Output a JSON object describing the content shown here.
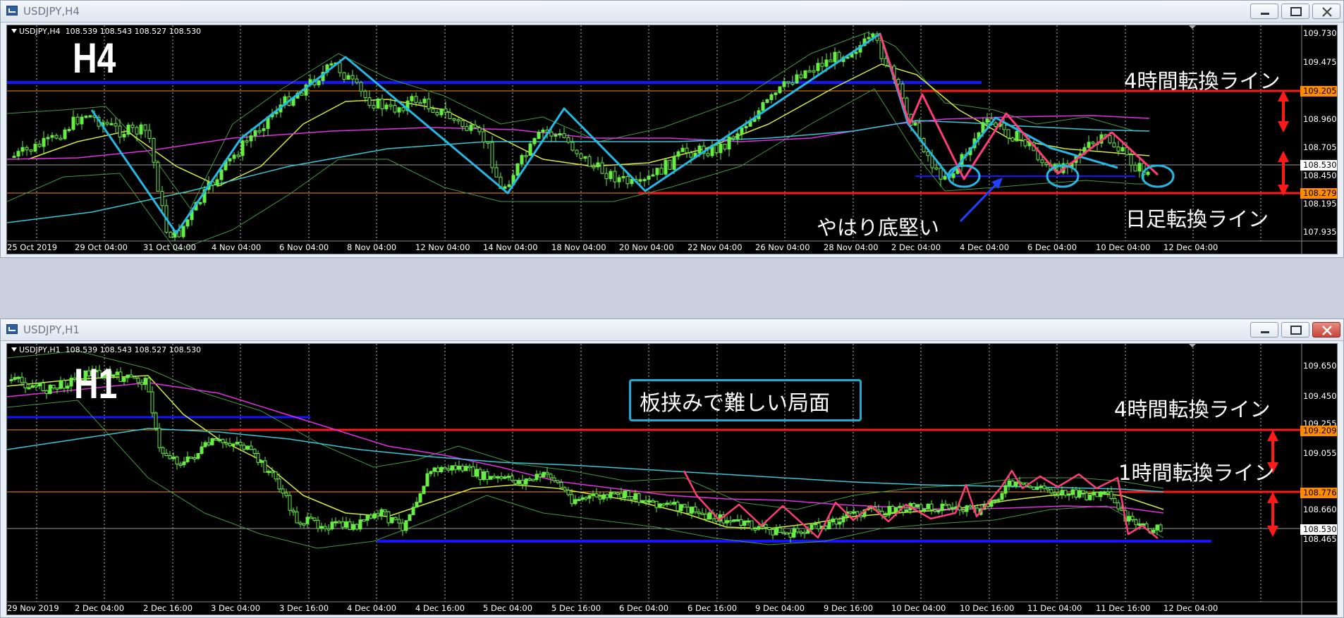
{
  "windows": [
    {
      "title": "USDJPY,H4",
      "symbol_line": "USDJPY,H4  108.539 108.543 108.527 108.530",
      "timeframe_label": "H4",
      "annotations": [
        "4時間転換ライン",
        "日足転換ライン",
        "やはり底堅い"
      ],
      "price_labels": [
        "109.730",
        "109.475",
        "108.960",
        "108.705",
        "108.450",
        "108.195",
        "107.935"
      ],
      "badges": [
        {
          "value": "109.205",
          "color": "#ff8c00"
        },
        {
          "value": "108.530",
          "color": "#ffffff"
        },
        {
          "value": "108.279",
          "color": "#ff8c00"
        }
      ],
      "time_labels": [
        "25 Oct 2019",
        "29 Oct 04:00",
        "31 Oct 04:00",
        "4 Nov 04:00",
        "6 Nov 04:00",
        "8 Nov 04:00",
        "12 Nov 04:00",
        "14 Nov 04:00",
        "18 Nov 04:00",
        "20 Nov 04:00",
        "22 Nov 04:00",
        "26 Nov 04:00",
        "28 Nov 04:00",
        "2 Dec 04:00",
        "4 Dec 04:00",
        "6 Dec 04:00",
        "10 Dec 04:00",
        "12 Dec 04:00"
      ]
    },
    {
      "title": "USDJPY,H1",
      "symbol_line": "USDJPY,H1  108.539 108.543 108.527 108.530",
      "timeframe_label": "H1",
      "annotations": [
        "板挟みで難しい局面",
        "4時間転換ライン",
        "1時間転換ライン"
      ],
      "price_labels": [
        "109.650",
        "109.450",
        "109.255",
        "109.055",
        "108.660",
        "108.465"
      ],
      "badges": [
        {
          "value": "109.209",
          "color": "#ff8c00"
        },
        {
          "value": "108.776",
          "color": "#ff8c00"
        },
        {
          "value": "108.530",
          "color": "#ffffff"
        }
      ],
      "time_labels": [
        "29 Nov 2019",
        "2 Dec 04:00",
        "2 Dec 16:00",
        "3 Dec 04:00",
        "3 Dec 16:00",
        "4 Dec 04:00",
        "4 Dec 16:00",
        "5 Dec 04:00",
        "5 Dec 16:00",
        "6 Dec 04:00",
        "6 Dec 16:00",
        "9 Dec 04:00",
        "9 Dec 16:00",
        "10 Dec 04:00",
        "10 Dec 16:00",
        "11 Dec 04:00",
        "11 Dec 16:00",
        "12 Dec 04:00"
      ]
    }
  ],
  "colors": {
    "resistance_line": "#ff1a1a",
    "support_line": "#1414ff",
    "zigzag_blue": "#25b8e6",
    "zigzag_pink": "#ff3c78",
    "ma_yellow": "#d8e83a",
    "ma_magenta": "#e52ee5",
    "ma_cyan": "#33c9d8",
    "bollinger": "#3f9a3f",
    "candle": "#66ee44"
  }
}
